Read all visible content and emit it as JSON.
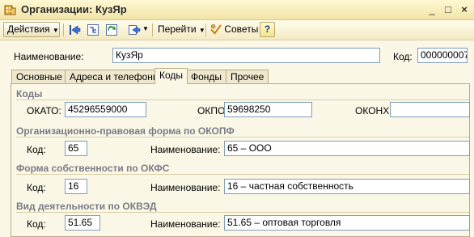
{
  "window": {
    "title": "Организации: КузЯр",
    "controls": [
      "_",
      "□",
      "×"
    ]
  },
  "toolbar": {
    "actions_label": "Действия",
    "goto_label": "Перейти",
    "tips_label": "Советы",
    "help_label": "?"
  },
  "form": {
    "name_label": "Наименование:",
    "name_value": "КузЯр",
    "code_label": "Код:",
    "code_value": "000000007"
  },
  "tabs": [
    "Основные",
    "Адреса и телефоны",
    "Коды",
    "Фонды",
    "Прочее"
  ],
  "active_tab": "Коды",
  "codes": {
    "title": "Коды",
    "okato_label": "ОКАТО:",
    "okato_value": "45296559000",
    "okpo_label": "ОКПО:",
    "okpo_value": "59698250",
    "okonh_label": "ОКОНХ:",
    "okonh_value": ""
  },
  "okopf": {
    "title": "Организационно-правовая форма по ОКОПФ",
    "code_label": "Код:",
    "code_value": "65",
    "name_label": "Наименование:",
    "name_value": "65 – ООО"
  },
  "okfs": {
    "title": "Форма собственности по ОКФС",
    "code_label": "Код:",
    "code_value": "16",
    "name_label": "Наименование:",
    "name_value": "16 – частная собственность"
  },
  "okved": {
    "title": "Вид деятельности по ОКВЭД",
    "code_label": "Код:",
    "code_value": "51.65",
    "name_label": "Наименование:",
    "name_value": "51.65 – оптовая торговля"
  }
}
